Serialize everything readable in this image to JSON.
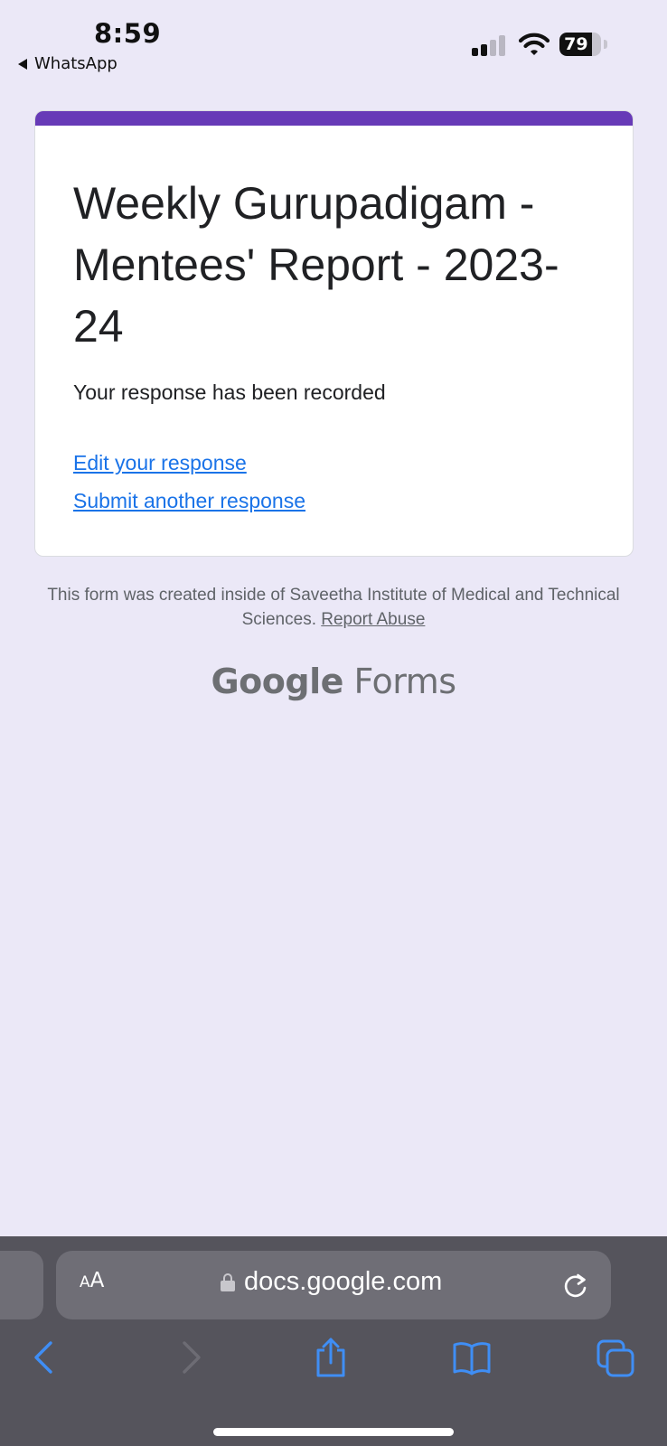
{
  "status_bar": {
    "time": "8:59",
    "back_app": "WhatsApp",
    "battery_percent": "79",
    "battery_level": 0.79,
    "signal_bars_active": 2,
    "signal_bars_total": 4
  },
  "form": {
    "accent_color": "#673ab7",
    "title": "Weekly Gurupadigam - Mentees' Report - 2023-24",
    "confirmation": "Your response has been recorded",
    "edit_link": "Edit your response",
    "submit_another_link": "Submit another response"
  },
  "footer": {
    "note": "This form was created inside of Saveetha Institute of Medical and Technical Sciences.",
    "report_abuse": "Report Abuse",
    "logo_google": "Google",
    "logo_forms": "Forms"
  },
  "browser": {
    "text_size_small": "A",
    "text_size_big": "A",
    "url": "docs.google.com"
  },
  "icons": {
    "back": "chevron-left-icon",
    "forward": "chevron-right-icon",
    "share": "share-icon",
    "bookmarks": "book-icon",
    "tabs": "tabs-icon",
    "reload": "reload-icon",
    "lock": "lock-icon"
  },
  "colors": {
    "link": "#1a73e8",
    "safari_blue": "#3f8ef5",
    "page_background": "#ebe8f7"
  }
}
